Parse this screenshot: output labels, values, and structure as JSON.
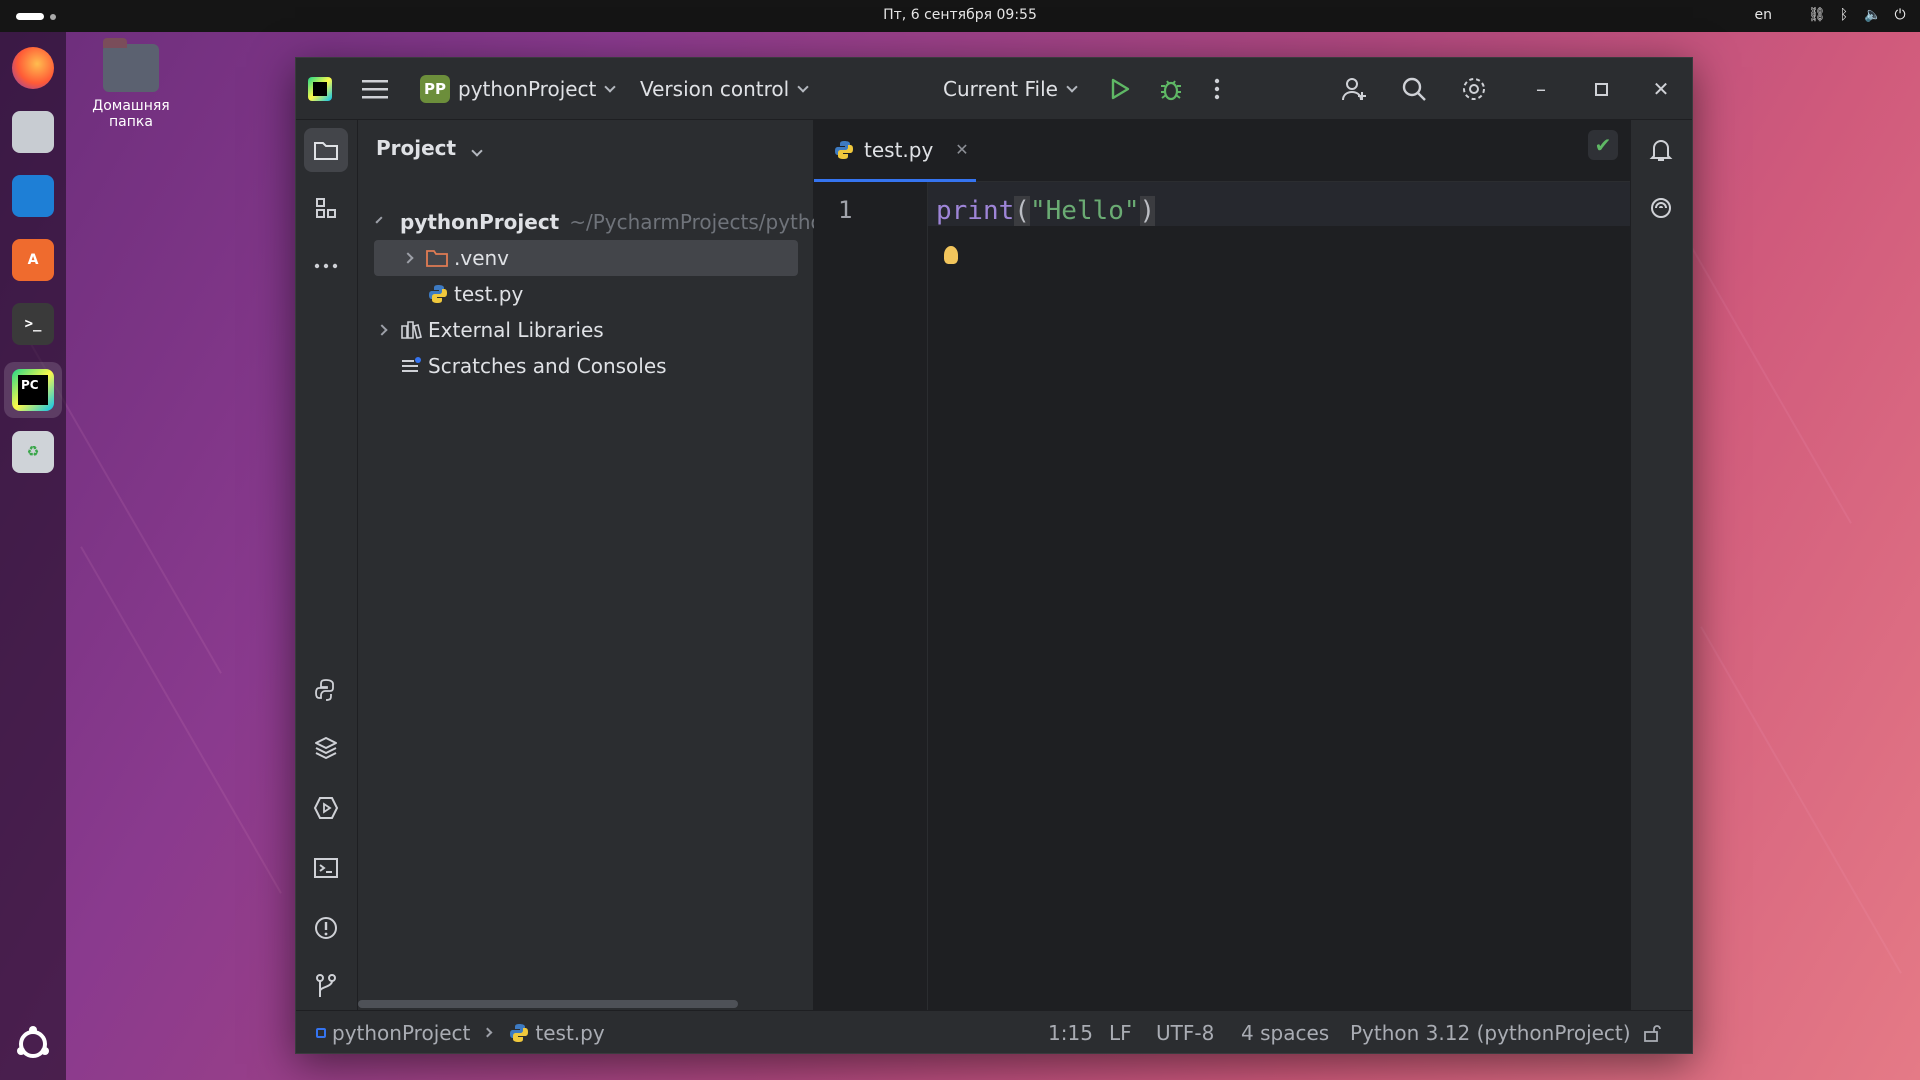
{
  "top_bar": {
    "clock": "Пт, 6 сентября  09:55",
    "lang": "en"
  },
  "desktop": {
    "home_folder_label": "Домашняя папка"
  },
  "ide": {
    "project_name": "pythonProject",
    "project_badge": "PP",
    "version_control": "Version control",
    "run_config": "Current File",
    "project_panel": {
      "title": "Project",
      "tree": [
        {
          "label": "pythonProject",
          "path": "~/PycharmProjects/pytho",
          "expanded": true
        },
        {
          "label": ".venv",
          "expanded": false
        },
        {
          "label": "test.py"
        },
        {
          "label": "External Libraries",
          "expanded": false
        },
        {
          "label": "Scratches and Consoles"
        }
      ]
    },
    "editor": {
      "tab_label": "test.py",
      "line_number": "1",
      "code_kw": "print",
      "code_open": "(",
      "code_str": "\"Hello\"",
      "code_close": ")"
    },
    "status": {
      "breadcrumb_project": "pythonProject",
      "breadcrumb_file": "test.py",
      "position": "1:15",
      "line_sep": "LF",
      "encoding": "UTF-8",
      "indent": "4 spaces",
      "interpreter": "Python 3.12 (pythonProject)"
    }
  }
}
